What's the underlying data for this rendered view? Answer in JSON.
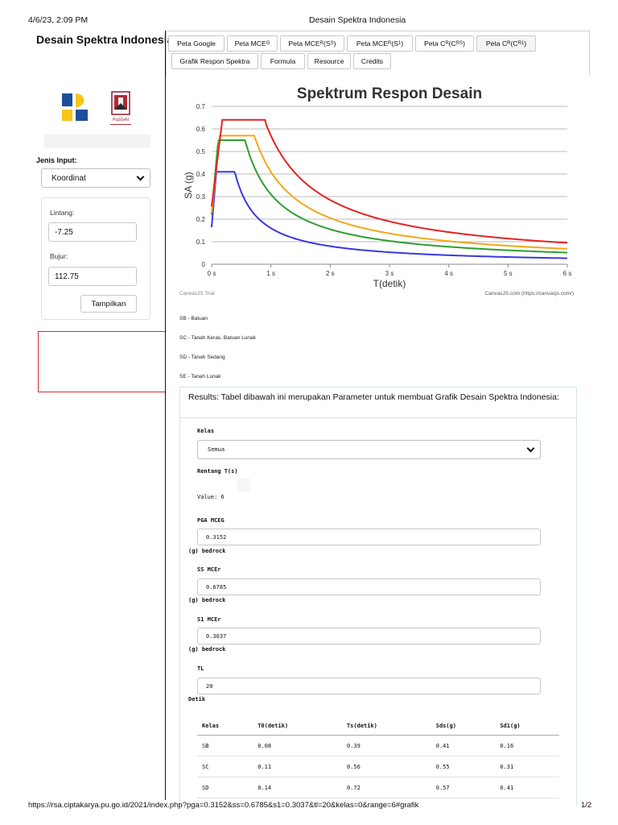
{
  "print_header": {
    "datetime": "4/6/23, 2:09 PM",
    "title": "Desain Spektra Indonesia"
  },
  "sidebar": {
    "site_title": "Desain Spektra Indonesia",
    "logo_right_text": "PuSGeN",
    "jenis_input_label": "Jenis Input:",
    "jenis_input_value": "Koordinat",
    "lintang_label": "Lintang:",
    "lintang_value": "-7.25",
    "bujur_label": "Bujur:",
    "bujur_value": "112.75",
    "tampilkan_button": "Tampilkan"
  },
  "tabs": {
    "peta_google": "Peta Google",
    "peta_mceg": {
      "main": "Peta MCE",
      "sub": "G"
    },
    "peta_mcer_ss": {
      "main": "Peta MCE",
      "sub": "R",
      "suffix": " (S",
      "sub2": "S",
      "end": ")"
    },
    "peta_mcer_s1": {
      "main": "Peta MCE",
      "sub": "R",
      "suffix": " (S",
      "sub2": "1",
      "end": ")"
    },
    "peta_cr_crs": {
      "main": "Peta C",
      "sub": "R",
      "suffix": " (C",
      "sub2": "RS",
      "end": ")"
    },
    "peta_cr_cr1": {
      "main": "Peta C",
      "sub": "R",
      "suffix": " (C",
      "sub2": "R1",
      "end": ")"
    },
    "grafik": "Grafik Respon Spektra",
    "formula": "Formula",
    "resource": "Resource",
    "credits": "Credits"
  },
  "chart_data": {
    "type": "line",
    "title": "Spektrum Respon Desain",
    "xlabel": "T(detik)",
    "ylabel": "SA (g)",
    "xlim": [
      0,
      6
    ],
    "ylim": [
      0,
      0.7
    ],
    "x_ticks": [
      "0 s",
      "1 s",
      "2 s",
      "3 s",
      "4 s",
      "5 s",
      "6 s"
    ],
    "y_ticks": [
      "0",
      "0.1",
      "0.2",
      "0.3",
      "0.4",
      "0.5",
      "0.6",
      "0.7"
    ],
    "grid": true,
    "watermark_left": "CanvasJS Trial",
    "watermark_right": "CanvasJS.com (https://canvasjs.com/)",
    "series": [
      {
        "color": "#3838e0",
        "T0": 0.08,
        "Ts": 0.39,
        "Sds": 0.41,
        "Sd1": 0.16,
        "start": 0.164
      },
      {
        "color": "#2e9d2e",
        "T0": 0.11,
        "Ts": 0.56,
        "Sds": 0.55,
        "Sd1": 0.31,
        "start": 0.22
      },
      {
        "color": "#f0a818",
        "T0": 0.14,
        "Ts": 0.72,
        "Sds": 0.57,
        "Sd1": 0.41,
        "start": 0.228
      },
      {
        "color": "#e52222",
        "T0": 0.18,
        "Ts": 0.9,
        "Sds": 0.64,
        "Sd1": 0.57,
        "start": 0.256
      }
    ]
  },
  "legend": {
    "sb": "SB - Batuan",
    "sc": "SC - Tanah Keras, Batuan Lunak",
    "sd": "SD - Tanah Sedang",
    "se": "SE - Tanah Lunak"
  },
  "results": {
    "title": "Results: Tabel dibawah ini merupakan Parameter untuk membuat Grafik Desain Spektra Indonesia:",
    "kelas_label": "Kelas",
    "kelas_value": "Semua",
    "rentang_label": "Rentang T(s)",
    "rentang_value": "Value: 6",
    "pga_label": "PGA MCEG",
    "pga_value": "0.3152",
    "pga_unit": "(g) bedrock",
    "ss_label": "SS MCEr",
    "ss_value": "0.6785",
    "ss_unit": "(g) bedrock",
    "s1_label": "S1 MCEr",
    "s1_value": "0.3037",
    "s1_unit": "(g) bedrock",
    "tl_label": "TL",
    "tl_value": "20",
    "tl_unit": "Detik",
    "table": {
      "headers": [
        "Kelas",
        "T0(detik)",
        "Ts(detik)",
        "Sds(g)",
        "Sd1(g)"
      ],
      "rows": [
        [
          "SB",
          "0.08",
          "0.39",
          "0.41",
          "0.16"
        ],
        [
          "SC",
          "0.11",
          "0.56",
          "0.55",
          "0.31"
        ],
        [
          "SD",
          "0.14",
          "0.72",
          "0.57",
          "0.41"
        ]
      ]
    }
  },
  "footer": {
    "url": "https://rsa.ciptakarya.pu.go.id/2021/index.php?pga=0.3152&ss=0.6785&s1=0.3037&tl=20&kelas=0&range=6#grafik",
    "page": "1/2"
  }
}
